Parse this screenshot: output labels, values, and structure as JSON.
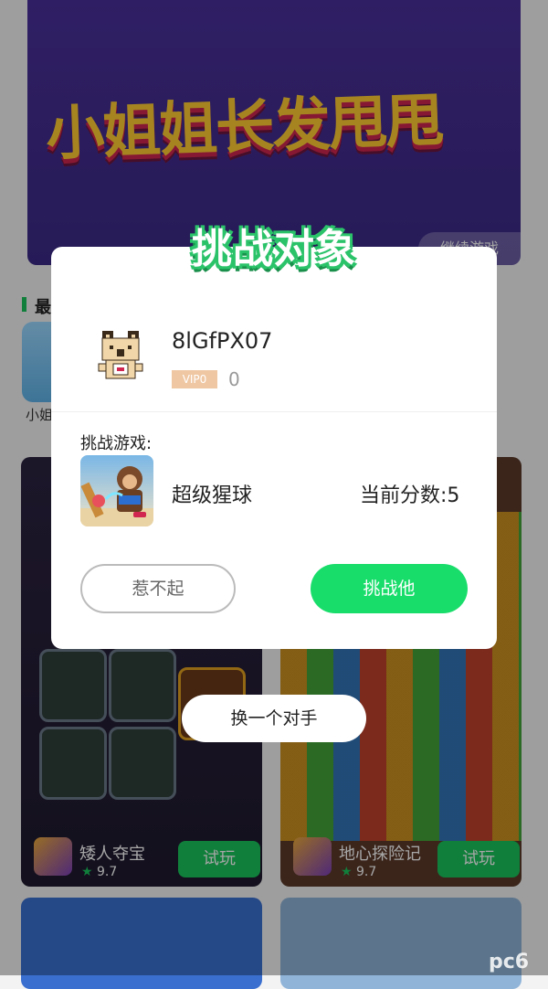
{
  "background": {
    "banner_title": "小姐姐长发甩甩",
    "continue_label": "继续游戏",
    "section_title": "最",
    "recent_game_name": "小姐",
    "cards": [
      {
        "name": "矮人夺宝",
        "rating": "9.7",
        "try_label": "试玩"
      },
      {
        "name": "地心探险记",
        "rating": "9.7",
        "try_label": "试玩"
      }
    ]
  },
  "modal": {
    "title": "挑战对象",
    "username": "8lGfPX07",
    "vip_label": "VIP0",
    "vip_score": "0",
    "challenge_label": "挑战游戏:",
    "game_name": "超级猩球",
    "current_score": "当前分数:5",
    "decline_label": "惹不起",
    "challenge_button_label": "挑战他"
  },
  "switch_opponent_label": "换一个对手",
  "watermark": "pc6",
  "colors": {
    "accent_green": "#19dd6b",
    "vip_badge": "#efc7a3"
  }
}
